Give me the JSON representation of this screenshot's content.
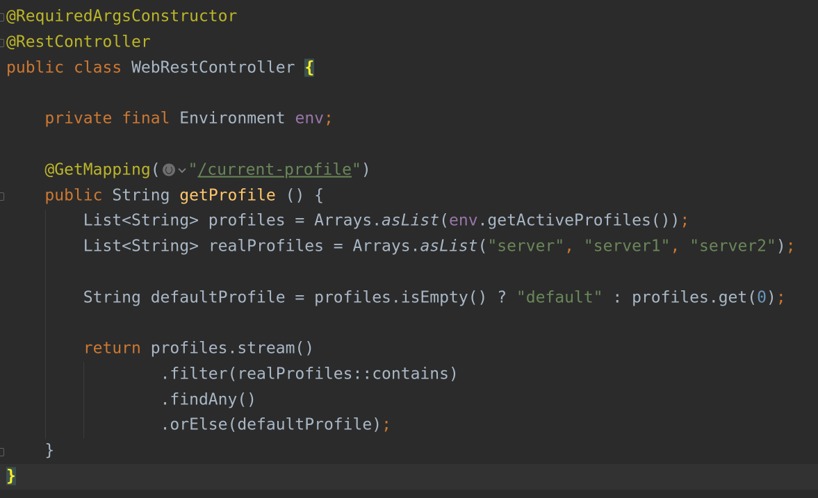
{
  "code": {
    "line1": {
      "annotation": "@RequiredArgsConstructor"
    },
    "line2": {
      "annotation": "@RestController"
    },
    "line3": {
      "kw1": "public",
      "kw2": "class",
      "name": "WebRestController",
      "brace": "{"
    },
    "line5": {
      "kw1": "private",
      "kw2": "final",
      "type": "Environment",
      "field": "env",
      "semi": ";"
    },
    "line7": {
      "annotation": "@GetMapping",
      "open": "(",
      "q1": "\"",
      "url": "/current-profile",
      "q2": "\"",
      "close": ")"
    },
    "line8": {
      "kw": "public",
      "type": "String",
      "method": "getProfile",
      "rest": " () {"
    },
    "line9": {
      "pre": "List<String> profiles = Arrays.",
      "call": "asList",
      "p1": "(",
      "field": "env",
      "post": ".getActiveProfiles())",
      "semi": ";"
    },
    "line10": {
      "pre": "List<String> realProfiles = Arrays.",
      "call": "asList",
      "p1": "(",
      "s1": "\"server\"",
      "c1": ", ",
      "s2": "\"server1\"",
      "c2": ", ",
      "s3": "\"server2\"",
      "p2": ")",
      "semi": ";"
    },
    "line12": {
      "pre": "String defaultProfile = profiles.isEmpty() ? ",
      "str": "\"default\"",
      "mid": " : profiles.get(",
      "num": "0",
      "p2": ")",
      "semi": ";"
    },
    "line14": {
      "kw": "return",
      "rest": " profiles.stream()"
    },
    "line15": {
      "text": ".filter(realProfiles::contains)"
    },
    "line16": {
      "text": ".findAny()"
    },
    "line17": {
      "text": ".orElse(defaultProfile)",
      "semi": ";"
    },
    "line18": {
      "text": "}"
    },
    "line19": {
      "text": "}"
    }
  },
  "icons": [
    "fold-marker-icon",
    "globe-icon",
    "chevron-down-icon"
  ],
  "colors": {
    "background": "#2b2b2b",
    "current_line": "#323232",
    "default_text": "#a9b7c6",
    "keyword": "#cc7832",
    "annotation": "#bbb529",
    "string": "#6a8759",
    "field": "#9876aa",
    "method_declaration": "#ffc66d",
    "number": "#6897bb",
    "brace_match_bg": "#3b514d",
    "brace_match_fg": "#ffef28"
  }
}
